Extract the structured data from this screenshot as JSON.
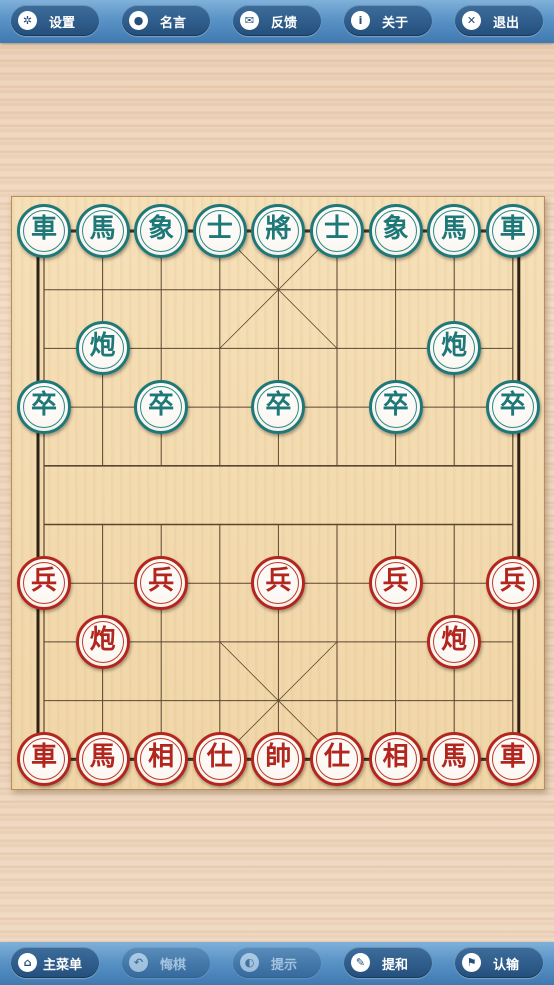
{
  "top_bar": {
    "buttons": [
      {
        "label": "设置",
        "icon": "gear-icon",
        "glyph": "✲"
      },
      {
        "label": "名言",
        "icon": "speech-bubble-icon",
        "glyph": "●"
      },
      {
        "label": "反馈",
        "icon": "envelope-icon",
        "glyph": "✉"
      },
      {
        "label": "关于",
        "icon": "info-icon",
        "glyph": "i"
      },
      {
        "label": "退出",
        "icon": "close-icon",
        "glyph": "✕"
      }
    ]
  },
  "bottom_bar": {
    "buttons": [
      {
        "label": "主菜单",
        "icon": "home-icon",
        "glyph": "⌂",
        "disabled": false
      },
      {
        "label": "悔棋",
        "icon": "undo-icon",
        "glyph": "↶",
        "disabled": true
      },
      {
        "label": "提示",
        "icon": "lightbulb-icon",
        "glyph": "◐",
        "disabled": true
      },
      {
        "label": "提和",
        "icon": "pencil-icon",
        "glyph": "✎",
        "disabled": false
      },
      {
        "label": "认输",
        "icon": "flag-icon",
        "glyph": "⚑",
        "disabled": false
      }
    ]
  },
  "board": {
    "files": 9,
    "ranks": 10,
    "colors": {
      "black": "#1f7878",
      "red": "#b3261e"
    },
    "pieces": [
      {
        "char": "車",
        "side": "black",
        "file": 0,
        "rank": 0
      },
      {
        "char": "馬",
        "side": "black",
        "file": 1,
        "rank": 0
      },
      {
        "char": "象",
        "side": "black",
        "file": 2,
        "rank": 0
      },
      {
        "char": "士",
        "side": "black",
        "file": 3,
        "rank": 0
      },
      {
        "char": "將",
        "side": "black",
        "file": 4,
        "rank": 0
      },
      {
        "char": "士",
        "side": "black",
        "file": 5,
        "rank": 0
      },
      {
        "char": "象",
        "side": "black",
        "file": 6,
        "rank": 0
      },
      {
        "char": "馬",
        "side": "black",
        "file": 7,
        "rank": 0
      },
      {
        "char": "車",
        "side": "black",
        "file": 8,
        "rank": 0
      },
      {
        "char": "炮",
        "side": "black",
        "file": 1,
        "rank": 2
      },
      {
        "char": "炮",
        "side": "black",
        "file": 7,
        "rank": 2
      },
      {
        "char": "卒",
        "side": "black",
        "file": 0,
        "rank": 3
      },
      {
        "char": "卒",
        "side": "black",
        "file": 2,
        "rank": 3
      },
      {
        "char": "卒",
        "side": "black",
        "file": 4,
        "rank": 3
      },
      {
        "char": "卒",
        "side": "black",
        "file": 6,
        "rank": 3
      },
      {
        "char": "卒",
        "side": "black",
        "file": 8,
        "rank": 3
      },
      {
        "char": "兵",
        "side": "red",
        "file": 0,
        "rank": 6
      },
      {
        "char": "兵",
        "side": "red",
        "file": 2,
        "rank": 6
      },
      {
        "char": "兵",
        "side": "red",
        "file": 4,
        "rank": 6
      },
      {
        "char": "兵",
        "side": "red",
        "file": 6,
        "rank": 6
      },
      {
        "char": "兵",
        "side": "red",
        "file": 8,
        "rank": 6
      },
      {
        "char": "炮",
        "side": "red",
        "file": 1,
        "rank": 7
      },
      {
        "char": "炮",
        "side": "red",
        "file": 7,
        "rank": 7
      },
      {
        "char": "車",
        "side": "red",
        "file": 0,
        "rank": 9
      },
      {
        "char": "馬",
        "side": "red",
        "file": 1,
        "rank": 9
      },
      {
        "char": "相",
        "side": "red",
        "file": 2,
        "rank": 9
      },
      {
        "char": "仕",
        "side": "red",
        "file": 3,
        "rank": 9
      },
      {
        "char": "帥",
        "side": "red",
        "file": 4,
        "rank": 9
      },
      {
        "char": "仕",
        "side": "red",
        "file": 5,
        "rank": 9
      },
      {
        "char": "相",
        "side": "red",
        "file": 6,
        "rank": 9
      },
      {
        "char": "馬",
        "side": "red",
        "file": 7,
        "rank": 9
      },
      {
        "char": "車",
        "side": "red",
        "file": 8,
        "rank": 9
      }
    ]
  }
}
